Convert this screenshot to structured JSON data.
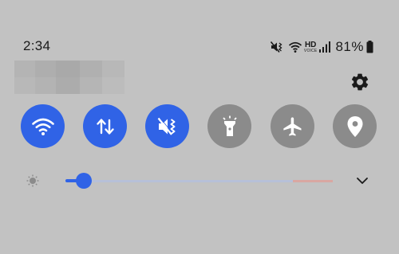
{
  "status_bar": {
    "time": "2:34",
    "hd_label": "HD",
    "volte_label": "VOICE",
    "battery_percent": "81%",
    "battery_level": 0.81,
    "icons": [
      "mute-vibrate-icon",
      "wifi-calling-icon",
      "hd-voice-badge",
      "signal-icon",
      "battery-icon"
    ]
  },
  "header": {
    "user_name_blurred": true,
    "settings_icon": "gear-icon"
  },
  "quick_toggles": [
    {
      "name": "wifi",
      "icon": "wifi-icon",
      "state": "on"
    },
    {
      "name": "mobile-data",
      "icon": "data-arrows-icon",
      "state": "on"
    },
    {
      "name": "sound-mode",
      "icon": "vibrate-icon",
      "state": "on"
    },
    {
      "name": "flashlight",
      "icon": "flashlight-icon",
      "state": "off"
    },
    {
      "name": "airplane-mode",
      "icon": "airplane-icon",
      "state": "off"
    },
    {
      "name": "location",
      "icon": "location-pin-icon",
      "state": "off"
    }
  ],
  "brightness": {
    "level": 0.07,
    "warning_zone_start": 0.85,
    "icon": "sun-icon",
    "expand_icon": "chevron-down-icon"
  },
  "colors": {
    "background": "#c2c2c2",
    "active": "#3063e6",
    "inactive": "#8b8b8b",
    "text": "#1a1a1a",
    "track": "#b7c0d8",
    "track_warning": "#d9a7a2"
  }
}
